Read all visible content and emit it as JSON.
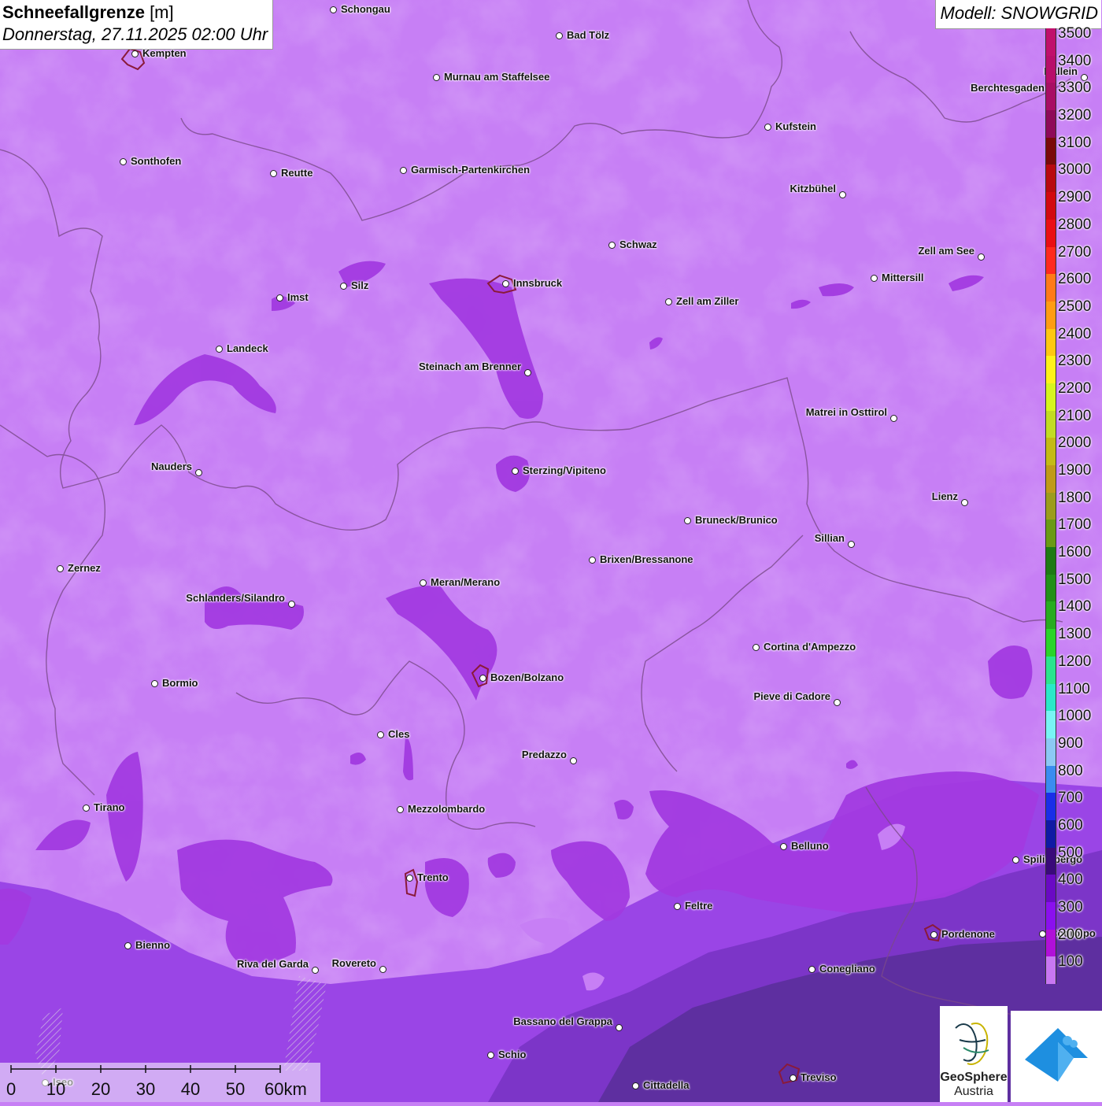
{
  "header": {
    "title_bold": "Schneefallgrenze",
    "title_unit": " [m]",
    "datetime": "Donnerstag, 27.11.2025 02:00 Uhr",
    "model": "Modell: SNOWGRID"
  },
  "cities": [
    {
      "name": "Schongau",
      "side": "r"
    },
    {
      "name": "Bad Tölz",
      "side": "r"
    },
    {
      "name": "Kempten",
      "side": "r"
    },
    {
      "name": "Murnau am Staffelsee",
      "side": "r"
    },
    {
      "name": "Berchtesgaden",
      "side": "l"
    },
    {
      "name": "Kufstein",
      "side": "r"
    },
    {
      "name": "Sonthofen",
      "side": "r"
    },
    {
      "name": "Reutte",
      "side": "r"
    },
    {
      "name": "Garmisch-Partenkirchen",
      "side": "r"
    },
    {
      "name": "Kitzbühel",
      "side": "l"
    },
    {
      "name": "Schwaz",
      "side": "r"
    },
    {
      "name": "Zell am See",
      "side": "l"
    },
    {
      "name": "Mittersill",
      "side": "r"
    },
    {
      "name": "Imst",
      "side": "r"
    },
    {
      "name": "Silz",
      "side": "r"
    },
    {
      "name": "Innsbruck",
      "side": "r"
    },
    {
      "name": "Zell am Ziller",
      "side": "r"
    },
    {
      "name": "Landeck",
      "side": "r"
    },
    {
      "name": "Steinach am Brenner",
      "side": "l"
    },
    {
      "name": "Matrei in Osttirol",
      "side": "l"
    },
    {
      "name": "Nauders",
      "side": "l"
    },
    {
      "name": "Sterzing/Vipiteno",
      "side": "r"
    },
    {
      "name": "Lienz",
      "side": "l"
    },
    {
      "name": "Bruneck/Brunico",
      "side": "r"
    },
    {
      "name": "Sillian",
      "side": "l"
    },
    {
      "name": "Brixen/Bressanone",
      "side": "r"
    },
    {
      "name": "Zernez",
      "side": "r"
    },
    {
      "name": "Meran/Merano",
      "side": "r"
    },
    {
      "name": "Schlanders/Silandro",
      "side": "l"
    },
    {
      "name": "Cortina d'Ampezzo",
      "side": "r"
    },
    {
      "name": "Bozen/Bolzano",
      "side": "r"
    },
    {
      "name": "Bormio",
      "side": "r"
    },
    {
      "name": "Pieve di Cadore",
      "side": "l"
    },
    {
      "name": "Cles",
      "side": "r"
    },
    {
      "name": "Predazzo",
      "side": "l"
    },
    {
      "name": "Tirano",
      "side": "r"
    },
    {
      "name": "Mezzolombardo",
      "side": "r"
    },
    {
      "name": "Belluno",
      "side": "r"
    },
    {
      "name": "Spilimbergo",
      "side": "r"
    },
    {
      "name": "Trento",
      "side": "r"
    },
    {
      "name": "Feltre",
      "side": "r"
    },
    {
      "name": "Pordenone",
      "side": "r"
    },
    {
      "name": "Codroipo",
      "side": "r"
    },
    {
      "name": "Bienno",
      "side": "r"
    },
    {
      "name": "Riva del Garda",
      "side": "l"
    },
    {
      "name": "Rovereto",
      "side": "l"
    },
    {
      "name": "Conegliano",
      "side": "r"
    },
    {
      "name": "Bassano del Grappa",
      "side": "l"
    },
    {
      "name": "Schio",
      "side": "r"
    },
    {
      "name": "Treviso",
      "side": "r"
    },
    {
      "name": "Cittadella",
      "side": "r"
    },
    {
      "name": "Hallein",
      "side": "l"
    },
    {
      "name": "Iseo",
      "side": "r"
    }
  ],
  "legend": {
    "levels": [
      {
        "label": "3500",
        "color": "#c0106c"
      },
      {
        "label": "3400",
        "color": "#b80e6a"
      },
      {
        "label": "3300",
        "color": "#a80e64"
      },
      {
        "label": "3200",
        "color": "#8e0a58"
      },
      {
        "label": "3100",
        "color": "#7a0a0a"
      },
      {
        "label": "3000",
        "color": "#b80a10"
      },
      {
        "label": "2900",
        "color": "#d20a10"
      },
      {
        "label": "2800",
        "color": "#ea0f14"
      },
      {
        "label": "2700",
        "color": "#ff2a1e"
      },
      {
        "label": "2600",
        "color": "#ff7a18"
      },
      {
        "label": "2500",
        "color": "#ff9c14"
      },
      {
        "label": "2400",
        "color": "#ffc812"
      },
      {
        "label": "2300",
        "color": "#fff21a"
      },
      {
        "label": "2200",
        "color": "#d6f51e"
      },
      {
        "label": "2100",
        "color": "#c2dc22"
      },
      {
        "label": "2000",
        "color": "#c4ba14"
      },
      {
        "label": "1900",
        "color": "#c09a18"
      },
      {
        "label": "1800",
        "color": "#9c9c1c"
      },
      {
        "label": "1700",
        "color": "#6a9a14"
      },
      {
        "label": "1600",
        "color": "#1e7a14"
      },
      {
        "label": "1500",
        "color": "#229018"
      },
      {
        "label": "1400",
        "color": "#28ac20"
      },
      {
        "label": "1300",
        "color": "#2ad42a"
      },
      {
        "label": "1200",
        "color": "#2ae48e"
      },
      {
        "label": "1100",
        "color": "#2ae8c8"
      },
      {
        "label": "1000",
        "color": "#78f4f4"
      },
      {
        "label": "900",
        "color": "#8cc8f4"
      },
      {
        "label": "800",
        "color": "#3a8cf0"
      },
      {
        "label": "700",
        "color": "#1a2ee8"
      },
      {
        "label": "600",
        "color": "#101aa4"
      },
      {
        "label": "500",
        "color": "#3a0a7a"
      },
      {
        "label": "400",
        "color": "#6a0ac4"
      },
      {
        "label": "300",
        "color": "#8a10ee"
      },
      {
        "label": "200",
        "color": "#b010d8"
      },
      {
        "label": "100",
        "color": "#c877f2"
      }
    ]
  },
  "scale_bar": {
    "labels": [
      "0",
      "10",
      "20",
      "30",
      "40",
      "50",
      "60km"
    ]
  },
  "logos": {
    "geosphere_line1": "GeoSphere",
    "geosphere_line2": "Austria"
  },
  "colors": {
    "base": "#c77ff5",
    "zone_200": "#a23ae0",
    "zone_300": "#8a2ad8",
    "zone_400_plain": "#7c2fc4",
    "zone_500_plain": "#5c2a9a",
    "border": "#7a4a8a"
  }
}
